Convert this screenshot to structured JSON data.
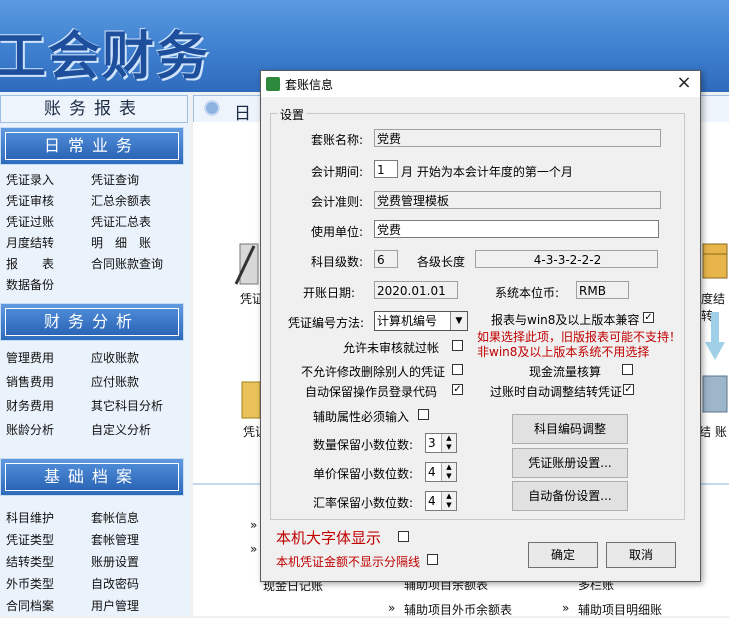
{
  "app": {
    "banner_title": "工会财务",
    "left_header": "账务报表",
    "sections": [
      {
        "title": "日常业务",
        "items": [
          [
            "凭证录入",
            "凭证查询"
          ],
          [
            "凭证审核",
            "汇总余额表"
          ],
          [
            "凭证过账",
            "凭证汇总表"
          ],
          [
            "月度结转",
            "明　细　账"
          ],
          [
            "报　　表",
            "合同账款查询"
          ],
          [
            "数据备份",
            ""
          ]
        ]
      },
      {
        "title": "财务分析",
        "items": [
          [
            "管理费用",
            "应收账款"
          ],
          [
            "销售费用",
            "应付账款"
          ],
          [
            "财务费用",
            "其它科目分析"
          ],
          [
            "账龄分析",
            "自定义分析"
          ]
        ]
      },
      {
        "title": "基础档案",
        "items": [
          [
            "科目维护",
            "套帐信息"
          ],
          [
            "凭证类型",
            "套帐管理"
          ],
          [
            "结转类型",
            "账册设置"
          ],
          [
            "外币类型",
            "自改密码"
          ],
          [
            "合同档案",
            "用户管理"
          ]
        ]
      }
    ],
    "right_tab_label": "日",
    "right_labels": {
      "pz1": "凭证",
      "pz2": "凭证",
      "jz": "度结转",
      "zz": "结 账",
      "row1": "现金日记账",
      "row2": "辅助项目余额表",
      "row3": "多栏账",
      "row4": "辅助项目外币余额表",
      "row5": "辅助项目明细账"
    }
  },
  "dialog": {
    "title": "套账信息",
    "close": "×",
    "group_label": "设置",
    "fields": {
      "name_label": "套账名称:",
      "name_value": "党费",
      "period_label": "会计期间:",
      "period_value": "1",
      "period_suffix": "月 开始为本会计年度的第一个月",
      "standard_label": "会计准则:",
      "standard_value": "党费管理模板",
      "unit_label": "使用单位:",
      "unit_value": "党费",
      "levels_label": "科目级数:",
      "levels_value": "6",
      "lengths_label": "各级长度",
      "lengths_value": "4-3-3-2-2-2",
      "open_date_label": "开账日期:",
      "open_date_value": "2020.01.01",
      "currency_label": "系统本位币:",
      "currency_value": "RMB",
      "numbering_label": "凭证编号方法:",
      "numbering_value": "计算机编号",
      "compat_label": "报表与win8及以上版本兼容",
      "compat_checked": "✓",
      "warn1": "如果选择此项，旧版报表可能不支持！",
      "warn2": "非win8及以上版本系统不用选择",
      "allow_unaudited": "允许未审核就过帐",
      "cash_flow": "现金流量核算",
      "no_modify": "不允许修改删除别人的凭证",
      "auto_save": "自动保留操作员登录代码",
      "auto_save_checked": "✓",
      "auto_adjust": "过账时自动调整结转凭证",
      "auto_adjust_checked": "✓",
      "aux_required": "辅助属性必须输入",
      "qty_decimals_label": "数量保留小数位数:",
      "qty_decimals": "3",
      "price_decimals_label": "单价保留小数位数:",
      "price_decimals": "4",
      "rate_decimals_label": "汇率保留小数位数:",
      "rate_decimals": "4"
    },
    "buttons": {
      "subject_code": "科目编码调整",
      "voucher_book": "凭证账册设置...",
      "auto_backup": "自动备份设置...",
      "ok": "确定",
      "cancel": "取消"
    },
    "large_font": "本机大字体显示",
    "no_separator": "本机凭证金额不显示分隔线"
  }
}
